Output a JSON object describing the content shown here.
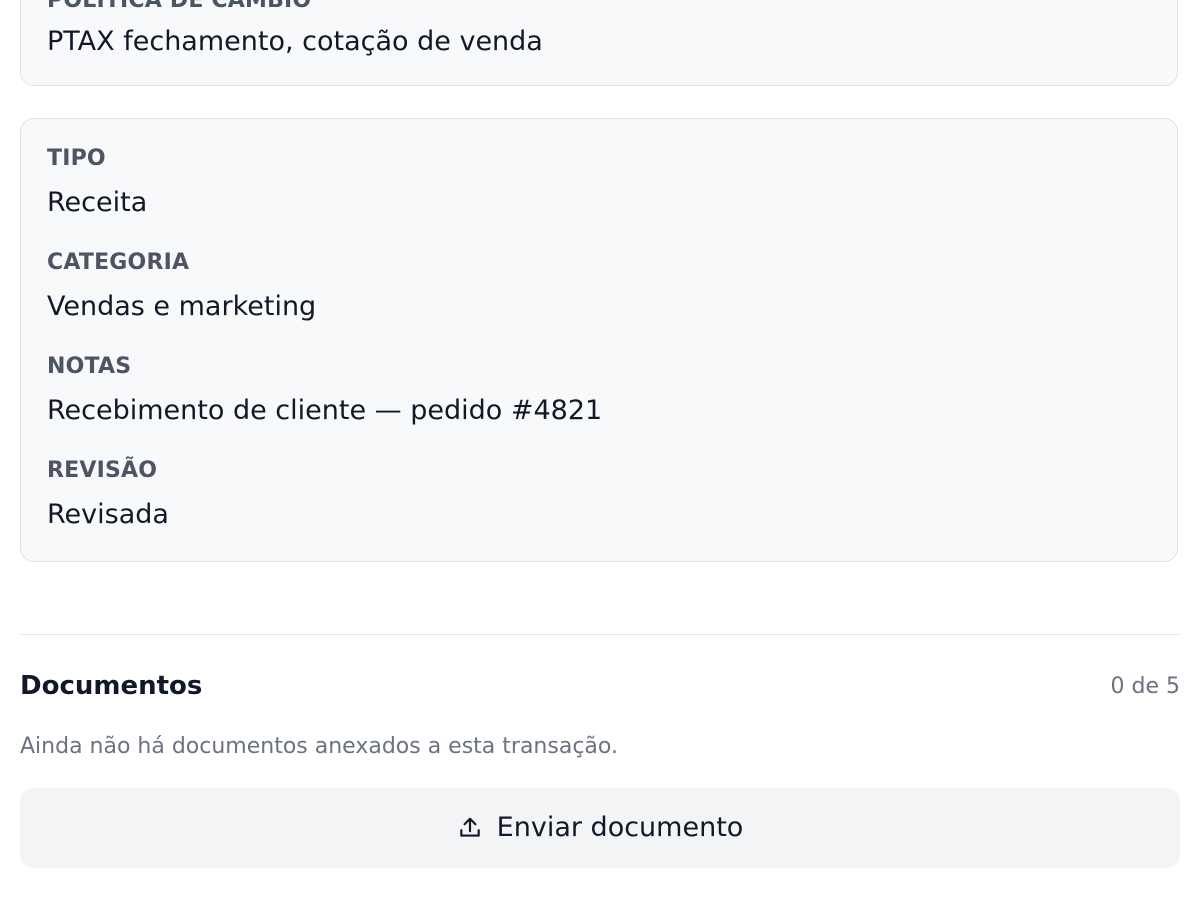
{
  "exchange_policy": {
    "label": "POLÍTICA DE CÂMBIO",
    "value": "PTAX fechamento, cotação de venda"
  },
  "details": {
    "type": {
      "label": "TIPO",
      "value": "Receita"
    },
    "category": {
      "label": "CATEGORIA",
      "value": "Vendas e marketing"
    },
    "notes": {
      "label": "NOTAS",
      "value": "Recebimento de cliente — pedido #4821"
    },
    "review": {
      "label": "REVISÃO",
      "value": "Revisada"
    }
  },
  "documents": {
    "title": "Documentos",
    "count": "0 de 5",
    "empty_message": "Ainda não há documentos anexados a esta transação.",
    "upload_label": "Enviar documento",
    "upload_icon": "upload-icon"
  }
}
